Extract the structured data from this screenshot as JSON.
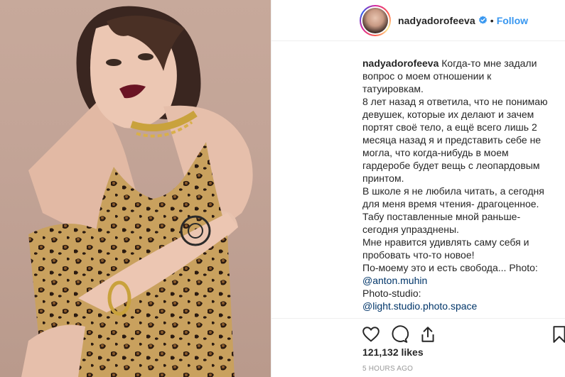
{
  "post": {
    "username": "nadyadorofeeva",
    "verified_icon": "verified-badge-icon",
    "separator": "•",
    "follow_label": "Follow",
    "caption_user": "nadyadorofeeva",
    "caption_lines": [
      "Когда-то мне задали вопрос о моем отношении к татуировкам.",
      "8 лет назад я ответила, что не понимаю девушек, которые их делают и зачем портят своё тело, а ещё всего лишь 2 месяца назад я и представить себе не могла, что когда-нибудь в моем гардеробе будет вещь с леопардовым принтом.",
      "В школе я не любила читать, а сегодня для меня время чтения- драгоценное.",
      "Табу поставленные мной раньше- сегодня упразднены.",
      "Мне нравится удивлять саму себя и пробовать что-то новое!",
      "По-моему это и есть свобода... Photo:"
    ],
    "mention_1": "@anton.muhin",
    "photo_studio_label": "Photo-studio:",
    "mention_2": "@light.studio.photo.space",
    "likes": "121,132 likes",
    "time": "5 HOURS AGO"
  },
  "icons": {
    "like": "heart-icon",
    "comment": "comment-icon",
    "share": "share-icon",
    "save": "bookmark-icon"
  },
  "colors": {
    "accent": "#3897f0",
    "mention": "#003569",
    "text": "#262626",
    "muted": "#999999",
    "border": "#efefef"
  }
}
